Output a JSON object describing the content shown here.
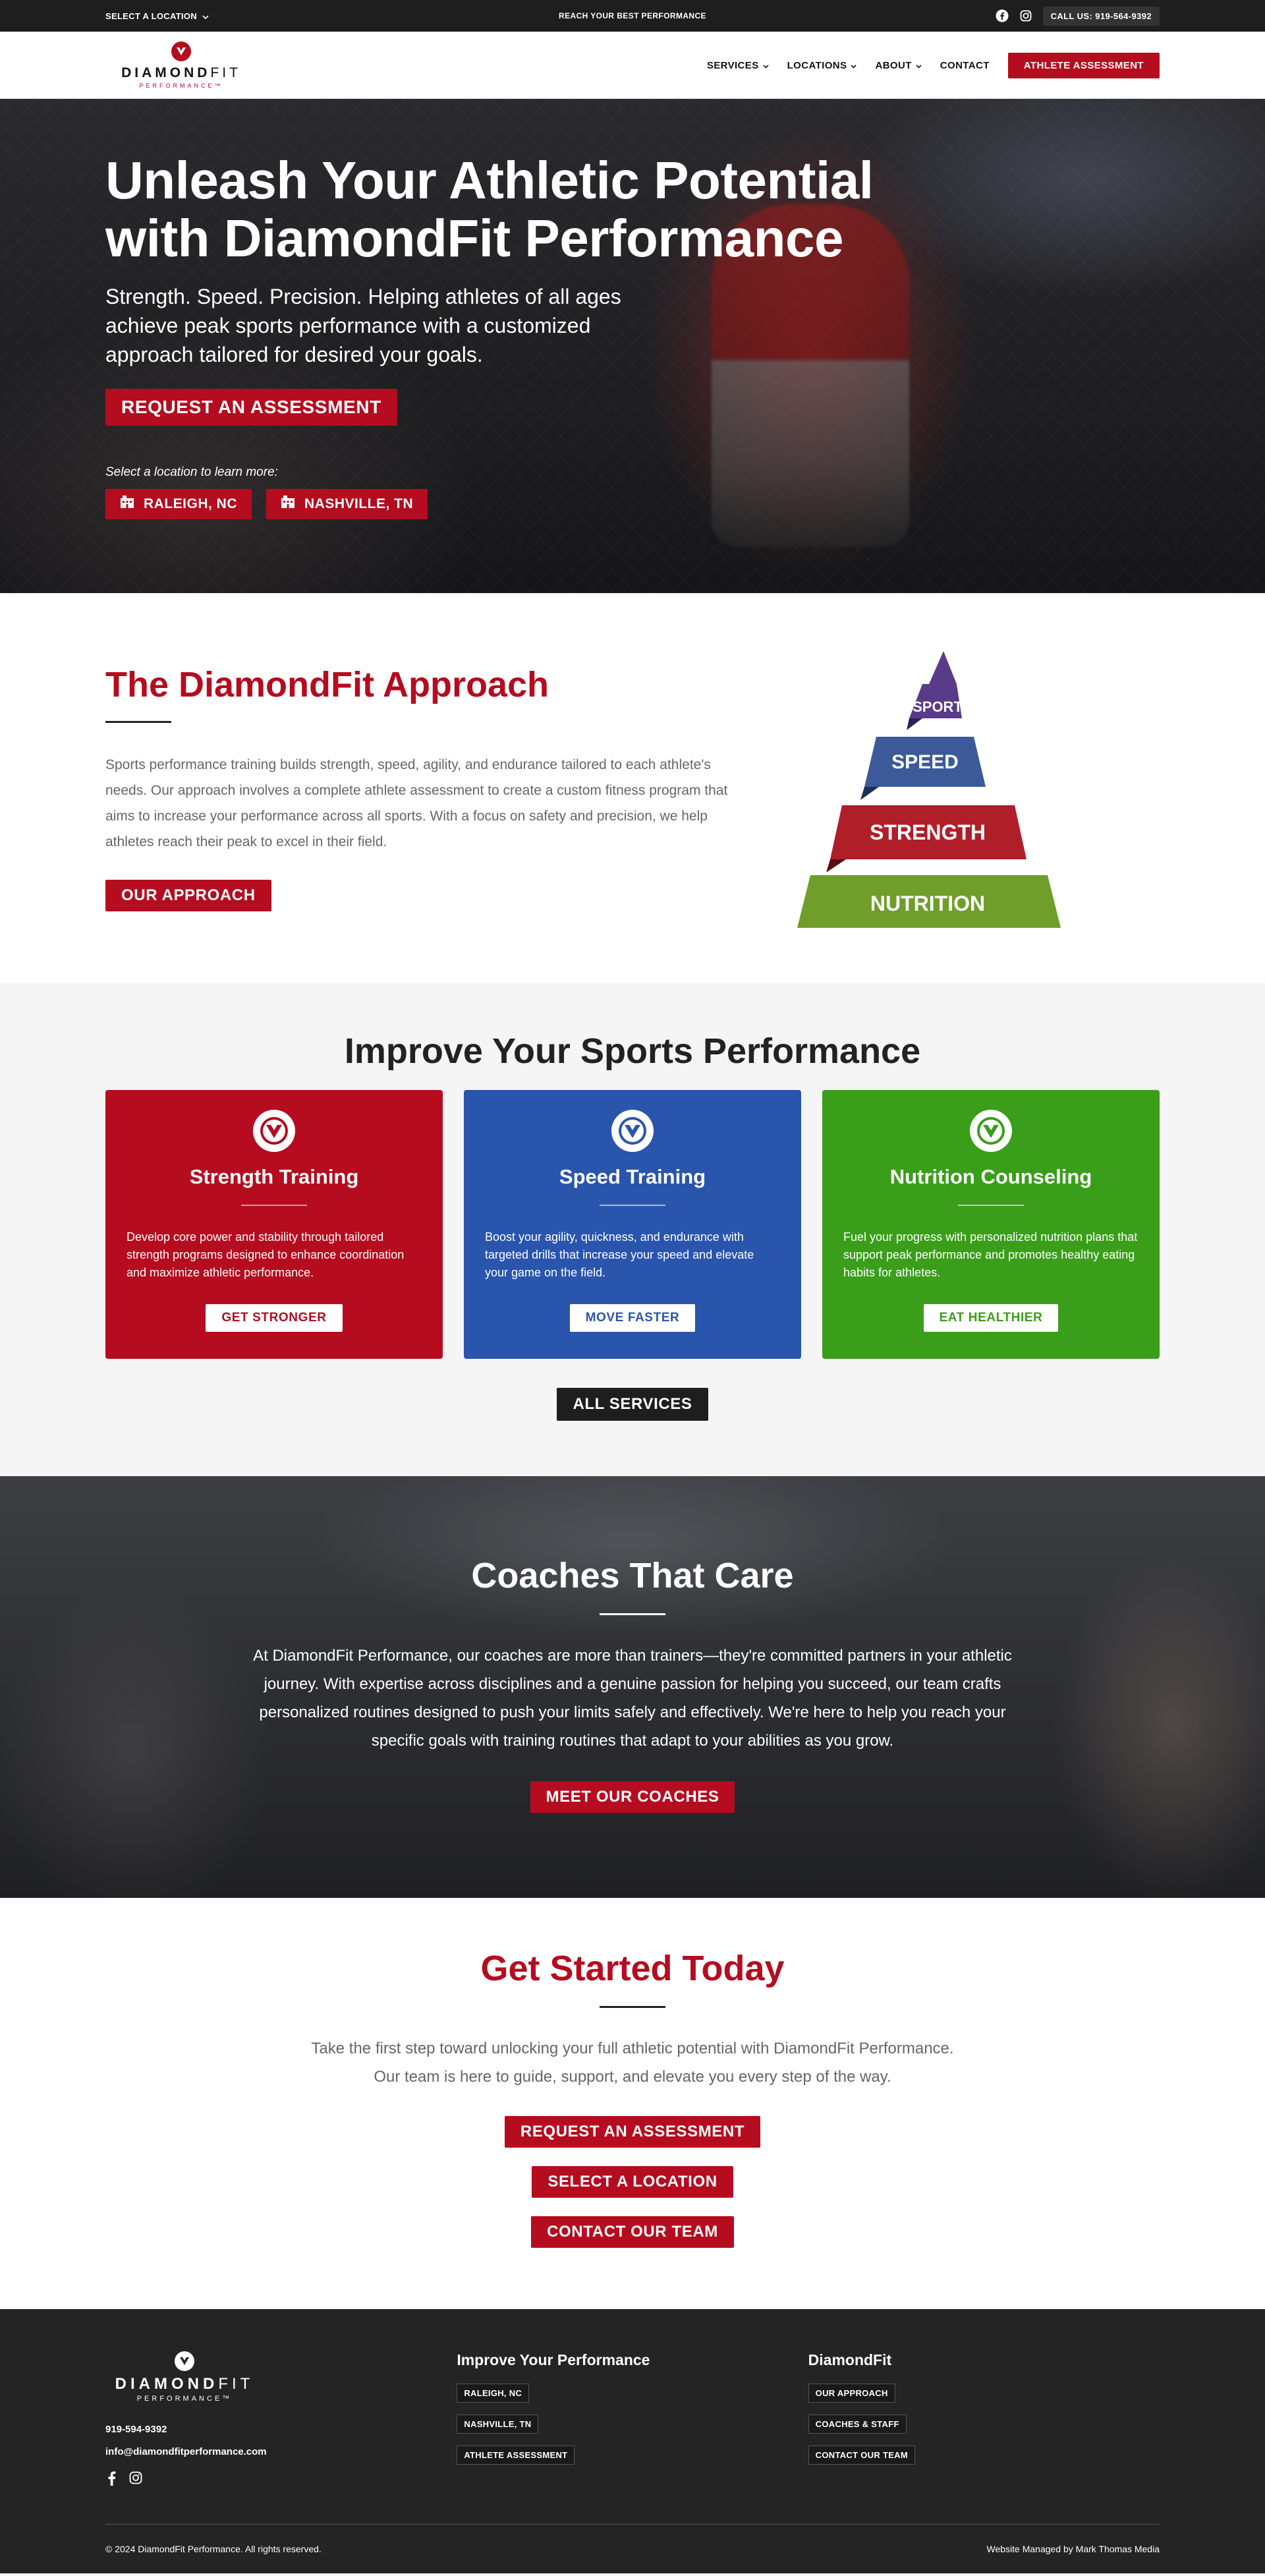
{
  "topbar": {
    "location_label": "SELECT A LOCATION",
    "tagline": "REACH YOUR BEST PERFORMANCE",
    "call_label": "CALL US: 919-564-9392",
    "social_icons": [
      "facebook-icon",
      "instagram-icon"
    ]
  },
  "header": {
    "logo_name_bold": "DIAMOND",
    "logo_name_light": "FIT",
    "logo_sub": "PERFORMANCE™",
    "nav": {
      "services": "SERVICES",
      "locations": "LOCATIONS",
      "about": "ABOUT",
      "contact": "CONTACT"
    },
    "cta": "ATHLETE ASSESSMENT"
  },
  "hero": {
    "title": "Unleash Your Athletic Potential with DiamondFit Performance",
    "subtitle": "Strength. Speed. Precision. Helping athletes of all ages achieve peak sports performance with a customized approach tailored for desired your goals.",
    "cta": "REQUEST AN ASSESSMENT",
    "select_label": "Select a location to learn more:",
    "locations": [
      "RALEIGH, NC",
      "NASHVILLE, TN"
    ]
  },
  "approach": {
    "title": "The DiamondFit Approach",
    "text": "Sports performance training builds strength, speed, agility, and endurance tailored to each athlete's needs. Our approach involves a complete athlete assessment to create a custom fitness program that aims to increase your performance across all sports. With a focus on safety and precision, we help athletes reach their peak to excel in their field.",
    "button": "OUR APPROACH",
    "pyramid": {
      "sport": "SPORT",
      "speed": "SPEED",
      "strength": "STRENGTH",
      "nutrition": "NUTRITION"
    }
  },
  "services": {
    "title": "Improve Your Sports Performance",
    "cards": [
      {
        "title": "Strength Training",
        "text": "Develop core power and stability through tailored strength programs designed to enhance coordination and maximize athletic performance.",
        "button": "GET STRONGER",
        "color": "#b50c1f"
      },
      {
        "title": "Speed Training",
        "text": "Boost your agility, quickness, and endurance with targeted drills that increase your speed and elevate your game on the field.",
        "button": "MOVE FASTER",
        "color": "#2a55ad"
      },
      {
        "title": "Nutrition Counseling",
        "text": "Fuel your progress with personalized nutrition plans that support peak performance and promotes healthy eating habits for athletes.",
        "button": "EAT HEALTHIER",
        "color": "#3a9e1a"
      }
    ],
    "all_button": "ALL SERVICES"
  },
  "coaches": {
    "title": "Coaches That Care",
    "text": "At DiamondFit Performance, our coaches are more than trainers—they're committed partners in your athletic journey. With expertise across disciplines and a genuine passion for helping you succeed, our team crafts personalized routines designed to push your limits safely and effectively. We're here to help you reach your specific goals with training routines that adapt to your abilities as you grow.",
    "button": "MEET OUR COACHES"
  },
  "started": {
    "title": "Get Started Today",
    "text": "Take the first step toward unlocking your full athletic potential with DiamondFit Performance. Our team is here to guide, support, and elevate you every step of the way.",
    "buttons": [
      "REQUEST AN ASSESSMENT",
      "SELECT A LOCATION",
      "CONTACT OUR TEAM"
    ]
  },
  "footer": {
    "logo_name_bold": "DIAMOND",
    "logo_name_light": "FIT",
    "logo_sub": "PERFORMANCE™",
    "phone": "919-594-9392",
    "email": "info@diamondfitperformance.com",
    "col1_title": "Improve Your Performance",
    "col1_links": [
      "RALEIGH, NC",
      "NASHVILLE, TN",
      "ATHLETE ASSESSMENT"
    ],
    "col2_title": "DiamondFit",
    "col2_links": [
      "OUR APPROACH",
      "COACHES & STAFF",
      "CONTACT OUR TEAM"
    ],
    "copyright": "© 2024 DiamondFit Performance. All rights reserved.",
    "credit": "Website Managed by Mark Thomas Media"
  },
  "colors": {
    "brand_red": "#b50c1f",
    "speed_blue": "#2a55ad",
    "nutrition_green": "#3a9e1a",
    "pyramid_purple": "#5a3b8a",
    "pyramid_blue": "#3c5a9a",
    "pyramid_green": "#6f9e2a",
    "dark": "#1e1e1e"
  }
}
